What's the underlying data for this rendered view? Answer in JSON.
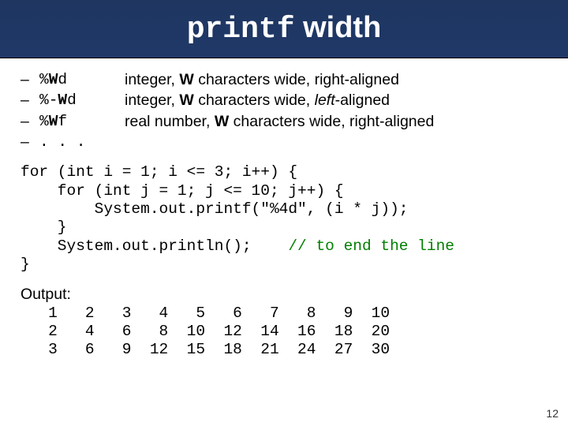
{
  "title": {
    "code_part": "printf",
    "rest": " width"
  },
  "bullets": [
    {
      "fmt_pre": "%",
      "fmt_bold": "W",
      "fmt_post": "d",
      "desc_pre": "integer, ",
      "desc_bold": "W",
      "desc_mid": " characters wide, right-aligned"
    },
    {
      "fmt_pre": "%-",
      "fmt_bold": "W",
      "fmt_post": "d",
      "desc_pre": "integer, ",
      "desc_bold": "W",
      "desc_mid": " characters wide, ",
      "desc_italic": "left",
      "desc_post": "-aligned"
    },
    {
      "fmt_pre": "%",
      "fmt_bold": "W",
      "fmt_post": "f",
      "desc_pre": "real number, ",
      "desc_bold": "W",
      "desc_mid": " characters wide, right-aligned"
    }
  ],
  "ellipsis": ". . .",
  "code": {
    "l1": "for (int i = 1; i <= 3; i++) {",
    "l2": "    for (int j = 1; j <= 10; j++) {",
    "l3": "        System.out.printf(\"%4d\", (i * j));",
    "l4": "    }",
    "l5a": "    System.out.println();    ",
    "l5c": "// to end the line",
    "l6": "}"
  },
  "output_label": "Output:",
  "output_rows": [
    "   1   2   3   4   5   6   7   8   9  10",
    "   2   4   6   8  10  12  14  16  18  20",
    "   3   6   9  12  15  18  21  24  27  30"
  ],
  "page_number": "12",
  "chart_data": {
    "type": "table",
    "title": "Multiplication table 1..3 × 1..10 printed with %4d",
    "columns": [
      1,
      2,
      3,
      4,
      5,
      6,
      7,
      8,
      9,
      10
    ],
    "rows": [
      [
        1,
        2,
        3,
        4,
        5,
        6,
        7,
        8,
        9,
        10
      ],
      [
        2,
        4,
        6,
        8,
        10,
        12,
        14,
        16,
        18,
        20
      ],
      [
        3,
        6,
        9,
        12,
        15,
        18,
        21,
        24,
        27,
        30
      ]
    ]
  }
}
